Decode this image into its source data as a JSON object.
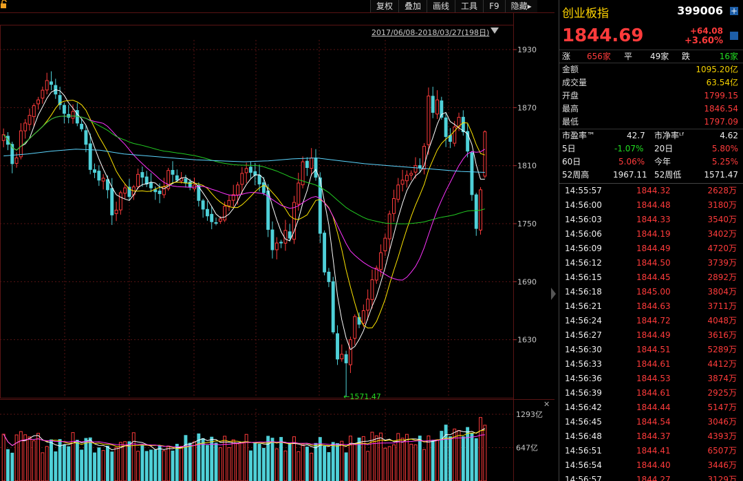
{
  "toolbar": [
    {
      "label": "复权"
    },
    {
      "label": "叠加"
    },
    {
      "label": "画线"
    },
    {
      "label": "工具"
    },
    {
      "label": "F9"
    },
    {
      "label": "隐藏▸"
    }
  ],
  "date_range": "2017/06/08-2018/03/27(198日)",
  "price_axis_labels": [
    "1930",
    "1870",
    "1810",
    "1750",
    "1690",
    "1630"
  ],
  "volume_axis_labels": [
    "1293亿",
    "647亿"
  ],
  "colors": {
    "up": "#ff3b3b",
    "down": "#4fd0d8",
    "ma5": "#ffffff",
    "ma10": "#ffe600",
    "ma20": "#ff33ff",
    "ma60": "#22cc22",
    "ma120": "#5cd6ff"
  },
  "quote": {
    "name": "创业板指",
    "code": "399006",
    "price": "1844.69",
    "change": "+64.08",
    "change_pct": "+3.60%",
    "breadth": {
      "up_label": "涨",
      "up_count": "656家",
      "flat_label": "平",
      "flat_count": "49家",
      "down_label": "跌",
      "down_count": "16家"
    },
    "stats": [
      {
        "label": "金额",
        "value": "1095.20亿"
      },
      {
        "label": "成交量",
        "value": "63.54亿"
      },
      {
        "label": "开盘",
        "value": "1799.15"
      },
      {
        "label": "最高",
        "value": "1846.54"
      },
      {
        "label": "最低",
        "value": "1797.09"
      }
    ],
    "ratios": {
      "pe_label": "市盈率™",
      "pe_value": "42.7",
      "pb_label": "市净率ᴸᶠ",
      "pb_value": "4.62"
    },
    "returns": [
      {
        "l1": "5日",
        "v1": "-1.07%",
        "l2": "20日",
        "v2": "5.80%"
      },
      {
        "l1": "60日",
        "v1": "5.06%",
        "l2": "今年",
        "v2": "5.25%"
      }
    ],
    "week52": {
      "high_label": "52周高",
      "high_value": "1967.11",
      "low_label": "52周低",
      "low_value": "1571.47"
    }
  },
  "ticks": [
    {
      "time": "14:55:57",
      "price": "1844.32",
      "vol": "2628万"
    },
    {
      "time": "14:56:00",
      "price": "1844.48",
      "vol": "3180万"
    },
    {
      "time": "14:56:03",
      "price": "1844.33",
      "vol": "3540万"
    },
    {
      "time": "14:56:06",
      "price": "1844.19",
      "vol": "3402万"
    },
    {
      "time": "14:56:09",
      "price": "1844.49",
      "vol": "4720万"
    },
    {
      "time": "14:56:12",
      "price": "1844.50",
      "vol": "3739万"
    },
    {
      "time": "14:56:15",
      "price": "1844.45",
      "vol": "2892万"
    },
    {
      "time": "14:56:18",
      "price": "1845.00",
      "vol": "3804万"
    },
    {
      "time": "14:56:21",
      "price": "1844.63",
      "vol": "3711万"
    },
    {
      "time": "14:56:24",
      "price": "1844.72",
      "vol": "4048万"
    },
    {
      "time": "14:56:27",
      "price": "1844.49",
      "vol": "3616万"
    },
    {
      "time": "14:56:30",
      "price": "1844.51",
      "vol": "5289万"
    },
    {
      "time": "14:56:33",
      "price": "1844.61",
      "vol": "4412万"
    },
    {
      "time": "14:56:36",
      "price": "1844.53",
      "vol": "3874万"
    },
    {
      "time": "14:56:39",
      "price": "1844.61",
      "vol": "2925万"
    },
    {
      "time": "14:56:42",
      "price": "1844.44",
      "vol": "5147万"
    },
    {
      "time": "14:56:45",
      "price": "1844.54",
      "vol": "3046万"
    },
    {
      "time": "14:56:48",
      "price": "1844.37",
      "vol": "4393万"
    },
    {
      "time": "14:56:51",
      "price": "1844.41",
      "vol": "6507万"
    },
    {
      "time": "14:56:54",
      "price": "1844.40",
      "vol": "3446万"
    },
    {
      "time": "14:56:57",
      "price": "1844.27",
      "vol": "3129万"
    }
  ],
  "chart_data": {
    "type": "candlestick",
    "y_range": [
      1570,
      1940
    ],
    "price_ticks": [
      1930,
      1870,
      1810,
      1750,
      1690,
      1630
    ],
    "low_annotation": "←1571.47",
    "low_value": 1571.47,
    "volume_range": [
      0,
      1400
    ],
    "volume_ticks": [
      1293,
      647
    ],
    "grid": true,
    "closes": [
      1842,
      1832,
      1812,
      1818,
      1846,
      1854,
      1862,
      1872,
      1878,
      1888,
      1898,
      1894,
      1884,
      1873,
      1864,
      1860,
      1866,
      1854,
      1848,
      1832,
      1806,
      1803,
      1795,
      1797,
      1785,
      1759,
      1764,
      1782,
      1787,
      1778,
      1788,
      1801,
      1798,
      1791,
      1787,
      1783,
      1781,
      1788,
      1805,
      1801,
      1795,
      1797,
      1792,
      1788,
      1790,
      1774,
      1765,
      1758,
      1752,
      1751,
      1755,
      1768,
      1774,
      1780,
      1790,
      1802,
      1807,
      1803,
      1800,
      1791,
      1782,
      1744,
      1723,
      1730,
      1730,
      1743,
      1735,
      1772,
      1792,
      1814,
      1808,
      1818,
      1798,
      1740,
      1700,
      1690,
      1638,
      1610,
      1615,
      1606,
      1630,
      1654,
      1646,
      1660,
      1672,
      1692,
      1704,
      1720,
      1735,
      1760,
      1776,
      1790,
      1795,
      1800,
      1802,
      1810,
      1808,
      1830,
      1882,
      1865,
      1878,
      1860,
      1840,
      1835,
      1850,
      1860,
      1845,
      1825,
      1780,
      1745,
      1785,
      1845
    ],
    "ma_series": [
      {
        "name": "MA5",
        "color": "#ffffff"
      },
      {
        "name": "MA10",
        "color": "#ffe600"
      },
      {
        "name": "MA20",
        "color": "#ff33ff"
      },
      {
        "name": "MA60",
        "color": "#22cc22"
      },
      {
        "name": "MA120",
        "color": "#5cd6ff",
        "values": [
          1820,
          1822,
          1825,
          1827,
          1826,
          1822,
          1820,
          1818,
          1816,
          1815,
          1814,
          1815,
          1817,
          1818,
          1815,
          1812,
          1810,
          1808,
          1806,
          1804,
          1803
        ]
      }
    ]
  }
}
